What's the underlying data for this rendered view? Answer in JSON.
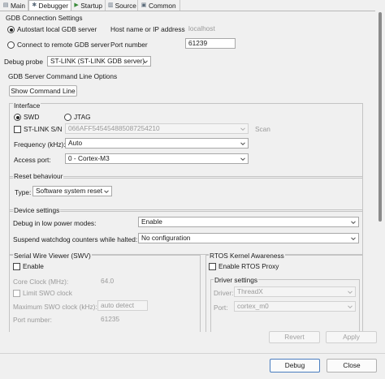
{
  "tabs": [
    {
      "label": "Main",
      "icon": "main-icon",
      "active": false
    },
    {
      "label": "Debugger",
      "icon": "debugger-icon",
      "active": true
    },
    {
      "label": "Startup",
      "icon": "startup-icon",
      "active": false
    },
    {
      "label": "Source",
      "icon": "source-icon",
      "active": false
    },
    {
      "label": "Common",
      "icon": "common-icon",
      "active": false
    }
  ],
  "gdb_connection": {
    "title": "GDB Connection Settings",
    "autostart_label": "Autostart local GDB server",
    "remote_label": "Connect to remote GDB server",
    "host_label": "Host name or IP address",
    "host_value": "localhost",
    "port_label": "Port number",
    "port_value": "61239",
    "autostart_selected": true
  },
  "debug_probe": {
    "label": "Debug probe",
    "value": "ST-LINK (ST-LINK GDB server)"
  },
  "server_options": {
    "title": "GDB Server Command Line Options",
    "show_command_line": "Show Command Line"
  },
  "interface": {
    "title": "Interface",
    "swd_label": "SWD",
    "jtag_label": "JTAG",
    "swd_selected": true,
    "stlink_sn_label": "ST-LINK S/N",
    "stlink_sn_value": "066AFF545454885087254210",
    "scan_label": "Scan",
    "frequency_label": "Frequency (kHz):",
    "frequency_value": "Auto",
    "access_port_label": "Access port:",
    "access_port_value": "0 - Cortex-M3"
  },
  "reset": {
    "title": "Reset behaviour",
    "type_label": "Type:",
    "type_value": "Software system reset"
  },
  "device": {
    "title": "Device settings",
    "low_power_label": "Debug in low power modes:",
    "low_power_value": "Enable",
    "watchdog_label": "Suspend watchdog counters while halted:",
    "watchdog_value": "No configuration"
  },
  "swv": {
    "title": "Serial Wire Viewer (SWV)",
    "enable_label": "Enable",
    "core_clock_label": "Core Clock (MHz):",
    "core_clock_value": "64.0",
    "limit_swo_label": "Limit SWO clock",
    "max_swo_label": "Maximum SWO clock (kHz):",
    "max_swo_value": "auto detect",
    "port_label": "Port number:",
    "port_value": "61235"
  },
  "rtos": {
    "title": "RTOS Kernel Awareness",
    "enable_label": "Enable RTOS Proxy",
    "driver_title": "Driver settings",
    "driver_label": "Driver:",
    "driver_value": "ThreadX",
    "port_label": "Port:",
    "port_value": "cortex_m0"
  },
  "footer": {
    "revert": "Revert",
    "apply": "Apply",
    "debug": "Debug",
    "close": "Close"
  },
  "colors": {
    "background": "#f0f0f0",
    "field_border": "#a8a8a8",
    "primary_border": "#4a7ec0"
  }
}
